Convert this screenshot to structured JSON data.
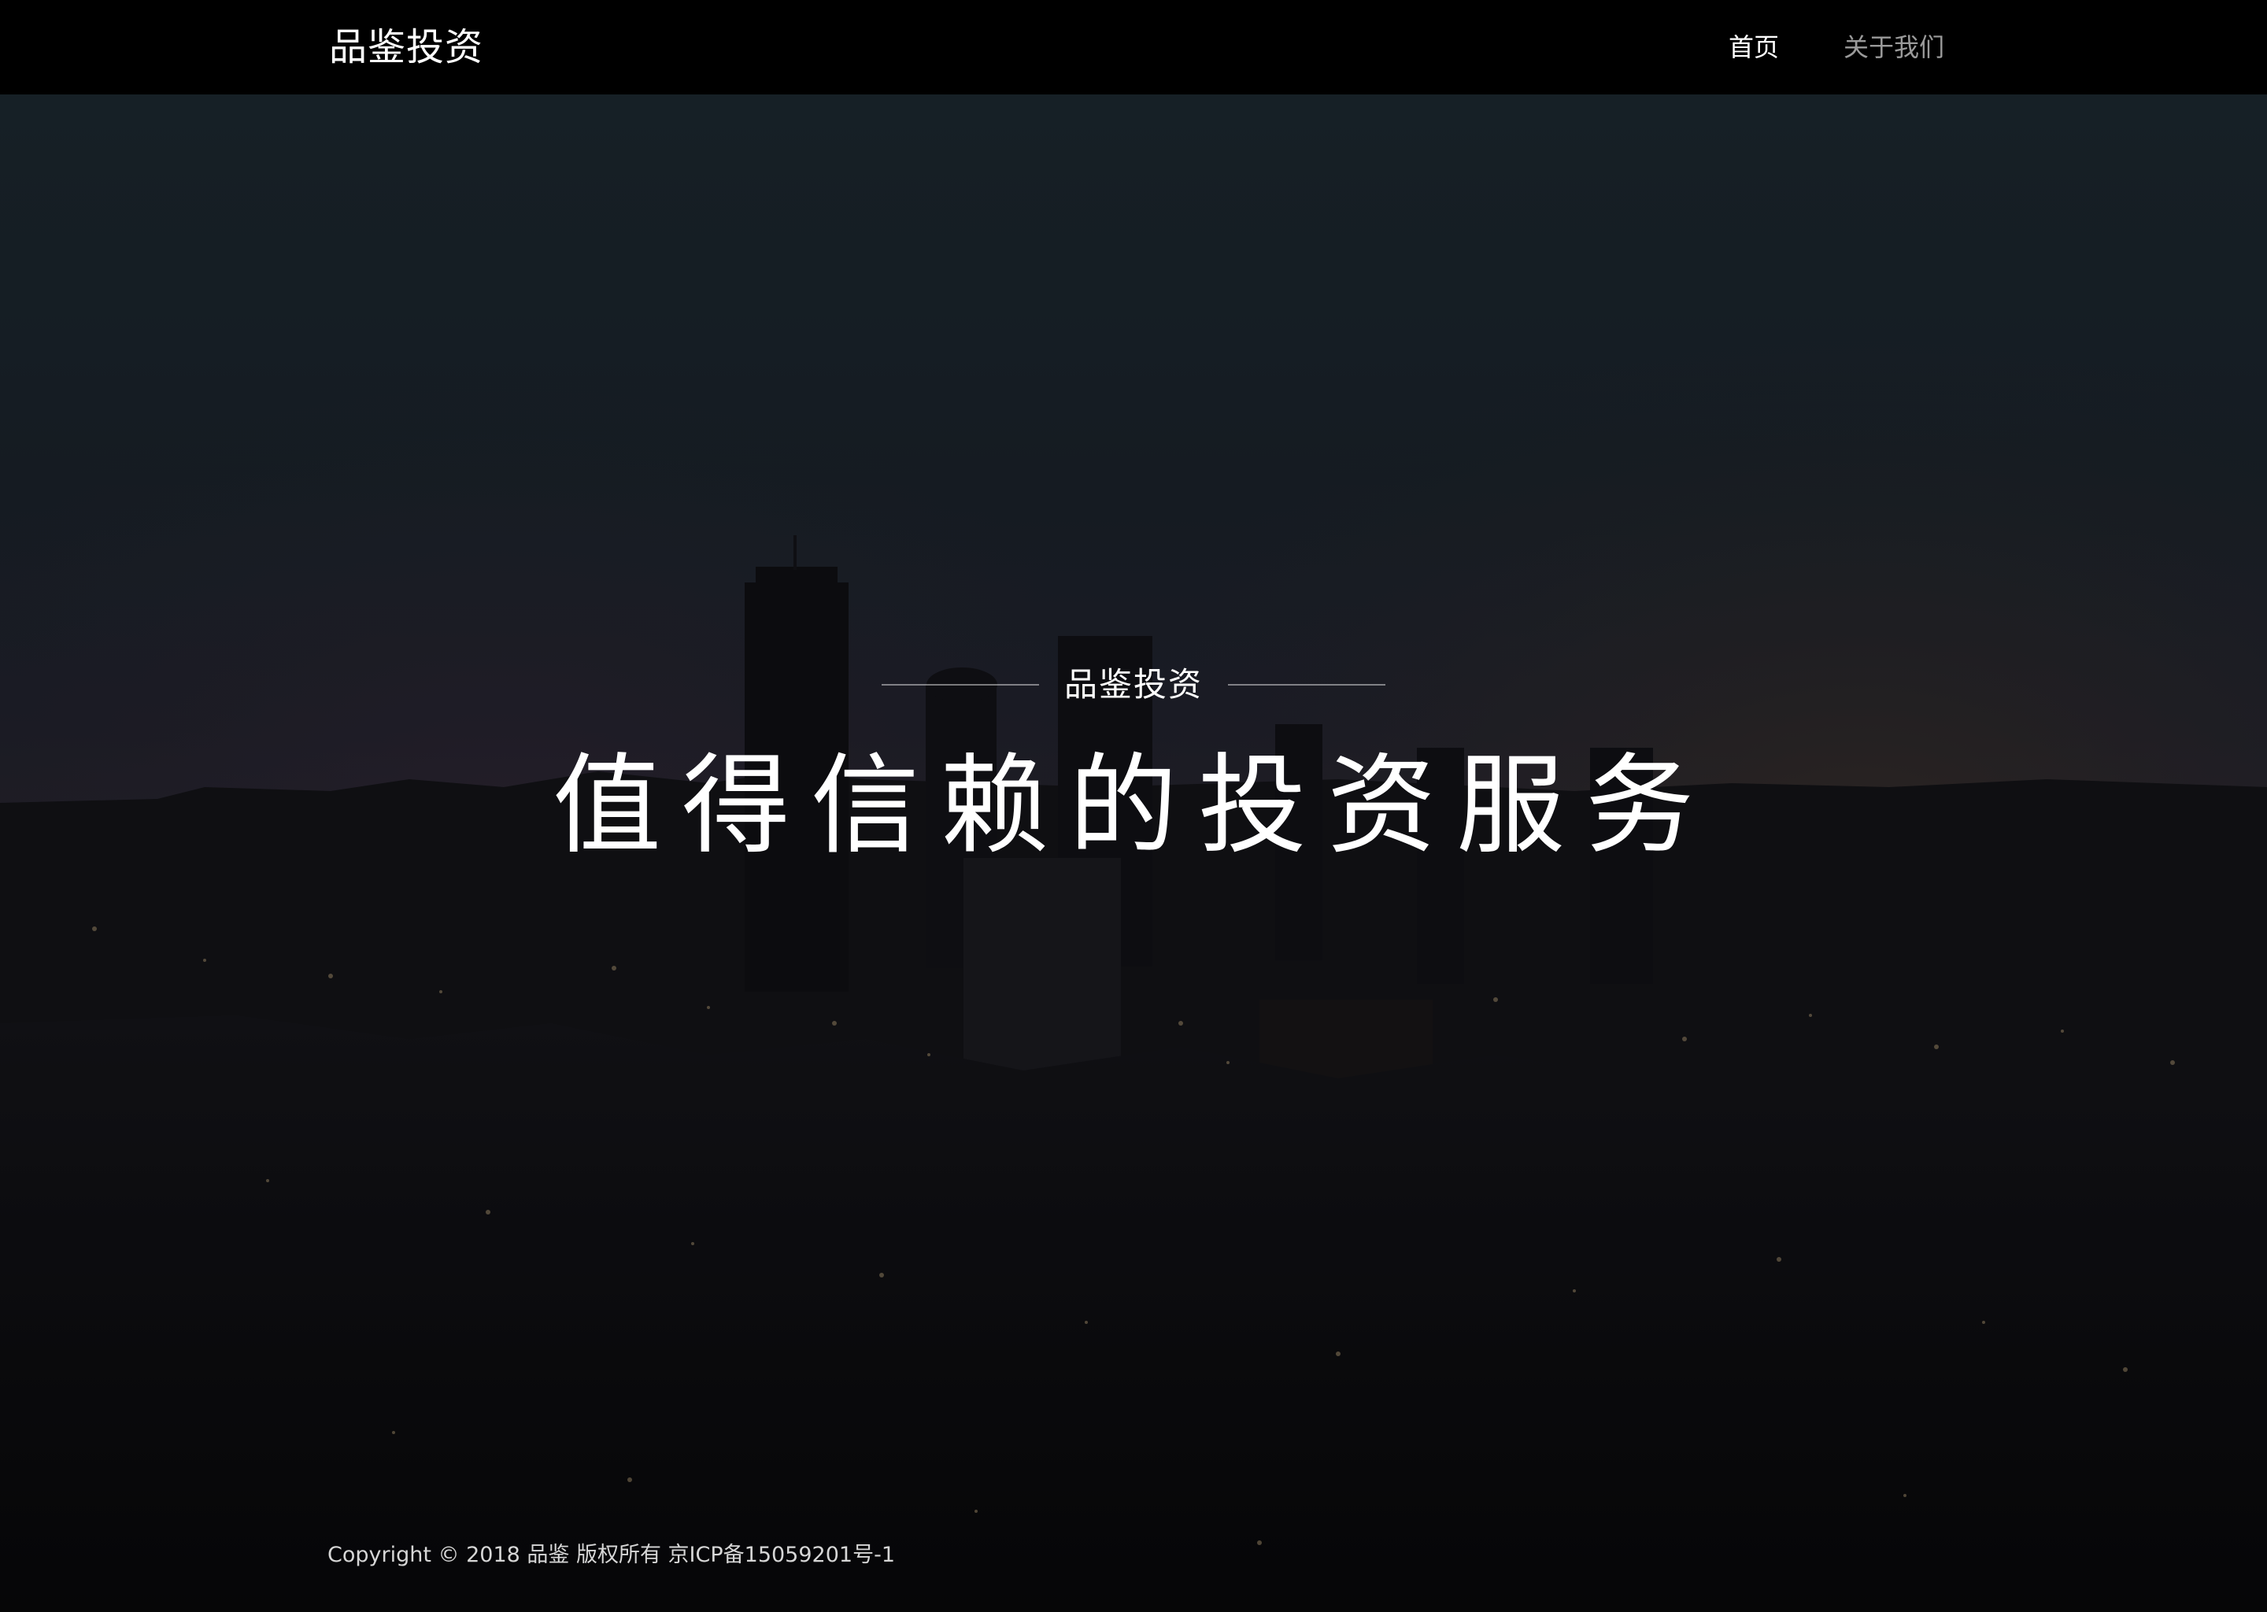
{
  "navbar": {
    "brand": "品鉴投资",
    "links": [
      {
        "label": "首页",
        "active": true
      },
      {
        "label": "关于我们",
        "active": false
      }
    ]
  },
  "hero": {
    "kicker": "品鉴投资",
    "title": "值得信赖的投资服务"
  },
  "footer": {
    "copyright": "Copyright © 2018 品鉴 版权所有 京ICP备15059201号-1"
  },
  "colors": {
    "navbar_bg": "#000000",
    "text_primary": "#ffffff",
    "nav_muted": "#9a9a9a",
    "sky_top": "#1d2a33",
    "sky_horizon": "#3a3240",
    "city_dark": "#0c0c10"
  }
}
